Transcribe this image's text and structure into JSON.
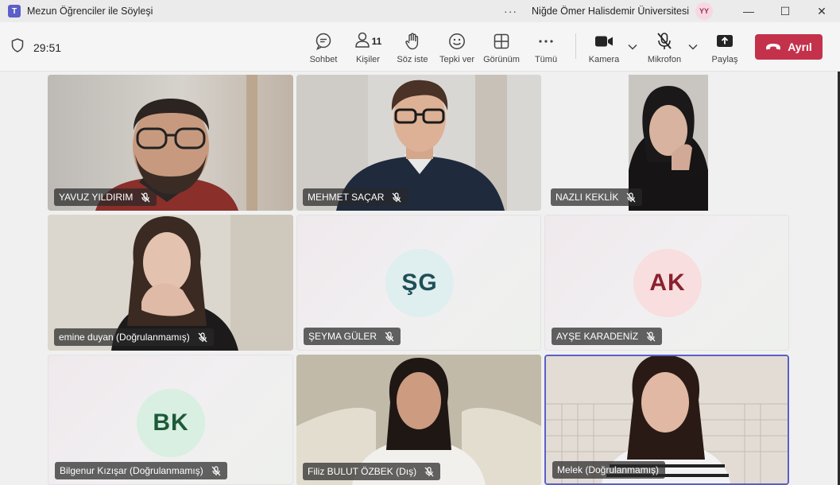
{
  "window": {
    "title": "Mezun Öğrenciler ile Söyleşi",
    "app_logo": "T",
    "more": "···",
    "organization": "Niğde Ömer Halisdemir Üniversitesi",
    "user_initials": "YY",
    "minimize": "—",
    "maximize": "☐",
    "close": "✕"
  },
  "toolbar": {
    "timer": "29:51",
    "chat": "Sohbet",
    "people": "Kişiler",
    "people_count": "11",
    "raise_hand": "Söz iste",
    "react": "Tepki ver",
    "view": "Görünüm",
    "more": "Tümü",
    "camera": "Kamera",
    "mic": "Mikrofon",
    "share": "Paylaş",
    "leave": "Ayrıl"
  },
  "participants": [
    {
      "name": "YAVUZ YILDIRIM",
      "type": "video"
    },
    {
      "name": "MEHMET SAÇAR",
      "type": "video"
    },
    {
      "name": "NAZLI KEKLİK",
      "type": "video"
    },
    {
      "name": "emine duyan (Doğrulanmamış)",
      "type": "video"
    },
    {
      "name": "ŞEYMA GÜLER",
      "type": "initials",
      "initials": "ŞG",
      "avatar_bg": "#dfeeee",
      "avatar_fg": "#1f4e57"
    },
    {
      "name": "AYŞE KARADENİZ",
      "type": "initials",
      "initials": "AK",
      "avatar_bg": "#f8dede",
      "avatar_fg": "#8a2130"
    },
    {
      "name": "Bilgenur Kızışar (Doğrulanmamış)",
      "type": "initials",
      "initials": "BK",
      "avatar_bg": "#d8efe2",
      "avatar_fg": "#1d5a37"
    },
    {
      "name": "Filiz BULUT ÖZBEK (Dış)",
      "type": "video"
    },
    {
      "name": "Melek (Doğrulanmamış)",
      "type": "video"
    }
  ],
  "colors": {
    "accent": "#5b5fc7",
    "leave": "#c4314b"
  }
}
